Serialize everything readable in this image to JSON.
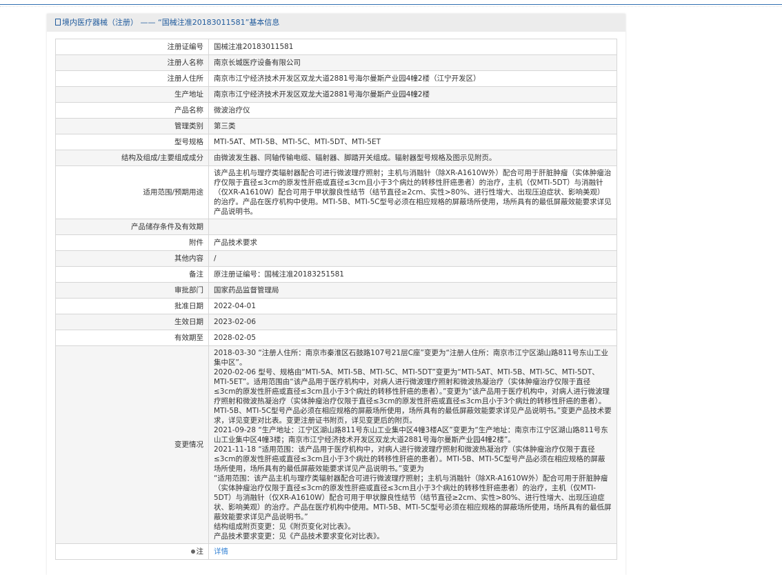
{
  "header": {
    "title": "境内医疗器械（注册） —— “国械注准20183011581”基本信息"
  },
  "rows": [
    {
      "label": "注册证编号",
      "value": "国械注准20183011581"
    },
    {
      "label": "注册人名称",
      "value": "南京长城医疗设备有限公司"
    },
    {
      "label": "注册人住所",
      "value": "南京市江宁经济技术开发区双龙大道2881号海尔曼斯产业园4幢2楼（江宁开发区）"
    },
    {
      "label": "生产地址",
      "value": "南京市江宁经济技术开发区双龙大道2881号海尔曼斯产业园4幢2楼"
    },
    {
      "label": "产品名称",
      "value": "微波治疗仪"
    },
    {
      "label": "管理类别",
      "value": "第三类"
    },
    {
      "label": "型号规格",
      "value": "MTI-5AT、MTI-5B、MTI-5C、MTI-5DT、MTI-5ET"
    },
    {
      "label": "结构及组成/主要组成成分",
      "value": "由微波发生器、同轴传输电缆、辐射器、脚踏开关组成。辐射器型号规格及图示见附页。"
    },
    {
      "label": "适用范围/预期用途",
      "value": "该产品主机与理疗类辐射器配合可进行微波理疗照射；主机与消融针（除XR-A1610W外）配合可用于肝脏肿瘤（实体肿瘤治疗仅限于直径≤3cm的原发性肝癌或直径≤3cm且小于3个病灶的转移性肝癌患者）的治疗，主机（仅MTI-5DT）与消融针（仅XR-A1610W）配合可用于甲状腺良性结节（结节直径≥2cm、实性>80%、进行性增大、出现压迫症状、影响美观）的治疗。产品在医疗机构中使用。MTI-5B、MTI-5C型号必须在相应规格的屏蔽场所使用，场所具有的最低屏蔽效能要求详见产品说明书。"
    },
    {
      "label": "产品储存条件及有效期",
      "value": ""
    },
    {
      "label": "附件",
      "value": "产品技术要求"
    },
    {
      "label": "其他内容",
      "value": "/"
    },
    {
      "label": "备注",
      "value": "原注册证编号：国械注准20183251581"
    },
    {
      "label": "审批部门",
      "value": "国家药品监督管理局"
    },
    {
      "label": "批准日期",
      "value": "2022-04-01"
    },
    {
      "label": "生效日期",
      "value": "2023-02-06"
    },
    {
      "label": "有效期至",
      "value": "2028-02-05"
    }
  ],
  "changes": {
    "label": "变更情况",
    "lines": [
      "2018-03-30 “注册人住所：南京市秦淮区石鼓路107号21层C座”变更为“注册人住所：南京市江宁区湖山路811号东山工业集中区”。",
      "2020-02-06 型号、规格由“MTI-5A、MTI-5B、MTI-5C、MTI-5DT”变更为“MTI-5AT、MTI-5B、MTI-5C、MTI-5DT、MTI-5ET”。适用范围由“该产品用于医疗机构中，对病人进行微波理疗照射和微波热凝治疗（实体肿瘤治疗仅限于直径≤3cm的原发性肝癌或直径≤3cm且小于3个病灶的转移性肝癌的患者）。”变更为“该产品用于医疗机构中，对病人进行微波理疗照射和微波热凝治疗（实体肿瘤治疗仅限于直径≤3cm的原发性肝癌或直径≤3cm且小于3个病灶的转移性肝癌的患者）。MTI-5B、MTI-5C型号产品必须在相应规格的屏蔽场所使用，场所具有的最低屏蔽效能要求详见产品说明书。”变更产品技术要求，详见变更对比表。变更注册证书附页，详见变更后的附页。",
      "2021-09-28 “生产地址：江宁区湖山路811号东山工业集中区4幢3楼A区”变更为“生产地址：南京市江宁区湖山路811号东山工业集中区4幢3楼；南京市江宁经济技术开发区双龙大道2881号海尔曼斯产业园4幢2楼”。",
      "2021-11-18 “适用范围：该产品用于医疗机构中，对病人进行微波理疗照射和微波热凝治疗（实体肿瘤治疗仅限于直径≤3cm的原发性肝癌或直径≤3cm且小于3个病灶的转移性肝癌的患者）。MTI-5B、MTI-5C型号产品必须在相应规格的屏蔽场所使用，场所具有的最低屏蔽效能要求详见产品说明书。”变更为",
      "“适用范围：该产品主机与理疗类辐射器配合可进行微波理疗照射；主机与消融针（除XR-A1610W外）配合可用于肝脏肿瘤（实体肿瘤治疗仅限于直径≤3cm的原发性肝癌或直径≤3cm且小于3个病灶的转移性肝癌患者）的治疗，主机（仅MTI-5DT）与消融针（仅XR-A1610W）配合可用于甲状腺良性结节（结节直径≥2cm、实性>80%、进行性增大、出现压迫症状、影响美观）的治疗。产品在医疗机构中使用。MTI-5B、MTI-5C型号必须在相应规格的屏蔽场所使用，场所具有的最低屏蔽效能要求详见产品说明书。”",
      "结构组成附页变更：见《附页变化对比表》。",
      "产品技术要求变更：见《产品技术要求变化对比表》。"
    ]
  },
  "note": {
    "label": "注",
    "link": "详情"
  }
}
